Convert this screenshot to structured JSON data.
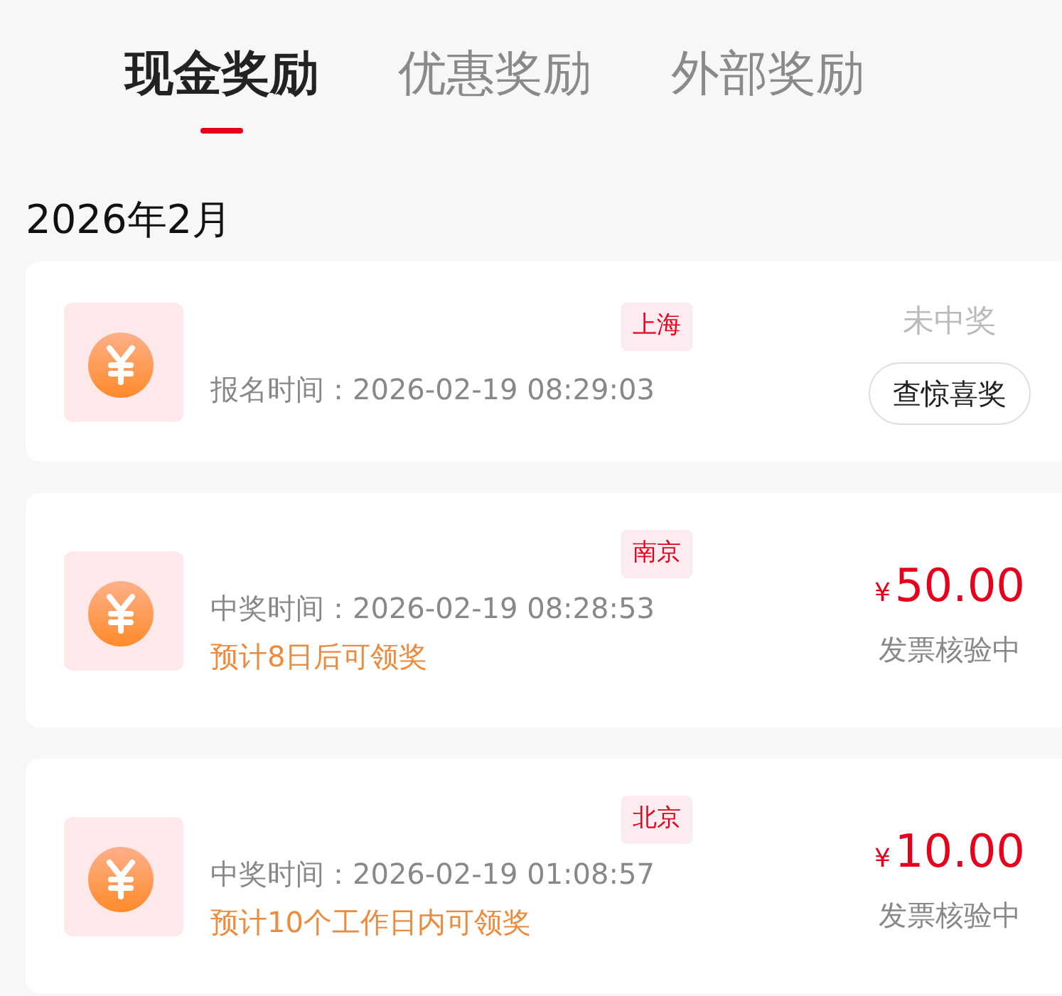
{
  "tabs": [
    {
      "label": "现金奖励",
      "selected": true
    },
    {
      "label": "优惠奖励",
      "selected": false
    },
    {
      "label": "外部奖励",
      "selected": false
    }
  ],
  "month": "2026年2月",
  "records": [
    {
      "kind": "not_won",
      "city": "上海",
      "time_line": "报名时间：2026-02-19 08:29:03",
      "status": "未中奖",
      "button": "查惊喜奖"
    },
    {
      "kind": "won",
      "city": "南京",
      "time_line": "中奖时间：2026-02-19 08:28:53",
      "note": "预计8日后可领奖",
      "currency": "¥",
      "amount": "50.00",
      "status": "发票核验中"
    },
    {
      "kind": "won",
      "city": "北京",
      "time_line": "中奖时间：2026-02-19 01:08:57",
      "note": "预计10个工作日内可领奖",
      "currency": "¥",
      "amount": "10.00",
      "status": "发票核验中"
    }
  ]
}
